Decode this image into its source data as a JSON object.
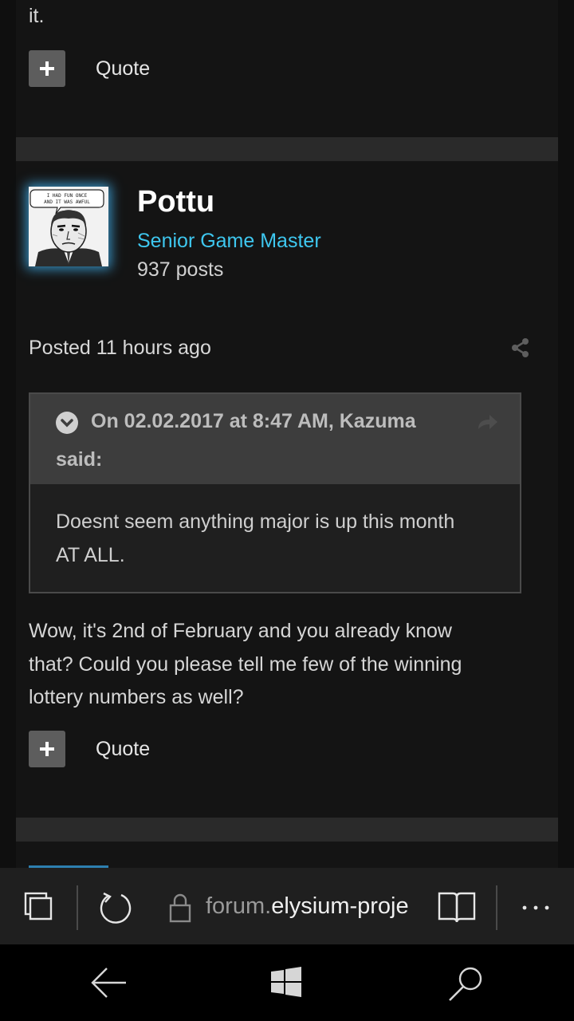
{
  "top_post": {
    "trailing_text": "it.",
    "quote_label": "Quote"
  },
  "post": {
    "author": "Pottu",
    "rank": "Senior Game Master",
    "post_count": "937 posts",
    "posted_time": "Posted 11 hours ago",
    "quote": {
      "header_line1": "On 02.02.2017 at 8:47 AM, Kazuma",
      "header_line2": "said:",
      "line1": "Doesnt seem anything major is up this month",
      "line2": "AT ALL."
    },
    "body_line1": "Wow, it's 2nd of February and you already know",
    "body_line2": "that? Could you please tell me few of the winning",
    "body_line3": "lottery numbers as well?",
    "quote_label": "Quote",
    "avatar_comic_text1": "I HAD FUN ONCE",
    "avatar_comic_text2": "AND IT WAS AWFUL"
  },
  "browser": {
    "url_domain_prefix": "forum.",
    "url_domain": "elysium-proje"
  },
  "colors": {
    "rank": "#3ec7ef",
    "accent_glow": "#46beff",
    "background": "#141414"
  }
}
